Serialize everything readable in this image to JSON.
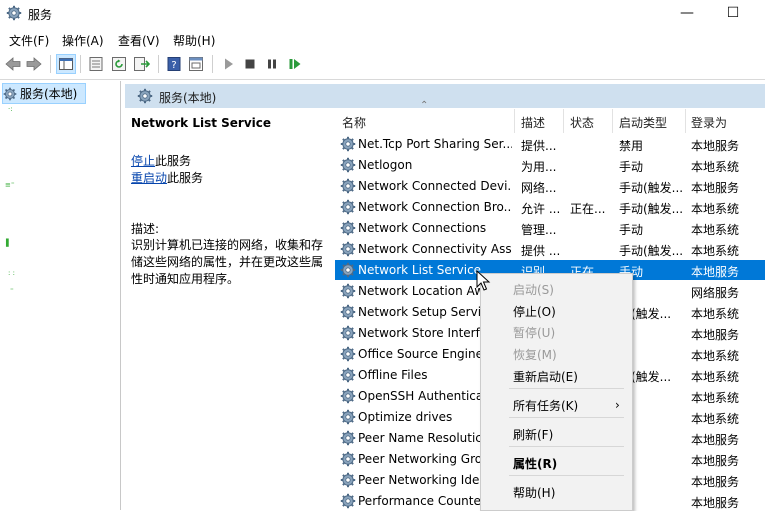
{
  "window": {
    "title": "服务",
    "minimize": "—",
    "maximize": "☐"
  },
  "menu": [
    "文件(F)",
    "操作(A)",
    "查看(V)",
    "帮助(H)"
  ],
  "tree": {
    "root": "服务(本地)"
  },
  "pane": {
    "header": "服务(本地)"
  },
  "detail": {
    "service_name": "Network List Service",
    "stop_link": "停止",
    "stop_suffix": "此服务",
    "restart_link": "重启动",
    "restart_suffix": "此服务",
    "desc_label": "描述:",
    "desc_text": "识别计算机已连接的网络，收集和存储这些网络的属性，并在更改这些属性时通知应用程序。"
  },
  "columns": [
    "名称",
    "描述",
    "状态",
    "启动类型",
    "登录为"
  ],
  "rows": [
    {
      "name": "Net.Tcp Port Sharing Ser...",
      "desc": "提供...",
      "status": "",
      "startup": "禁用",
      "logon": "本地服务"
    },
    {
      "name": "Netlogon",
      "desc": "为用...",
      "status": "",
      "startup": "手动",
      "logon": "本地系统"
    },
    {
      "name": "Network Connected Devi...",
      "desc": "网络...",
      "status": "",
      "startup": "手动(触发...",
      "logon": "本地服务"
    },
    {
      "name": "Network Connection Bro...",
      "desc": "允许 ...",
      "status": "正在...",
      "startup": "手动(触发...",
      "logon": "本地系统"
    },
    {
      "name": "Network Connections",
      "desc": "管理...",
      "status": "",
      "startup": "手动",
      "logon": "本地系统"
    },
    {
      "name": "Network Connectivity Ass...",
      "desc": "提供 ...",
      "status": "",
      "startup": "手动(触发...",
      "logon": "本地系统"
    },
    {
      "name": "Network List Service",
      "desc": "识别...",
      "status": "正在...",
      "startup": "手动",
      "logon": "本地服务",
      "selected": true
    },
    {
      "name": "Network Location Aw",
      "desc": "",
      "status": "",
      "startup": "动",
      "logon": "网络服务"
    },
    {
      "name": "Network Setup Servic",
      "desc": "",
      "status": "",
      "startup": "动(触发...",
      "logon": "本地系统"
    },
    {
      "name": "Network Store Interf",
      "desc": "",
      "status": "",
      "startup": "动",
      "logon": "本地服务"
    },
    {
      "name": "Office  Source Engine",
      "desc": "",
      "status": "",
      "startup": "动",
      "logon": "本地系统"
    },
    {
      "name": "Offline Files",
      "desc": "",
      "status": "",
      "startup": "动(触发...",
      "logon": "本地系统"
    },
    {
      "name": "OpenSSH Authenticat",
      "desc": "",
      "status": "",
      "startup": "用",
      "logon": "本地系统"
    },
    {
      "name": "Optimize drives",
      "desc": "",
      "status": "",
      "startup": "动",
      "logon": "本地系统"
    },
    {
      "name": "Peer Name Resolutic",
      "desc": "",
      "status": "",
      "startup": "动",
      "logon": "本地服务"
    },
    {
      "name": "Peer Networking Gro",
      "desc": "",
      "status": "",
      "startup": "动",
      "logon": "本地服务"
    },
    {
      "name": "Peer Networking Ide",
      "desc": "",
      "status": "",
      "startup": "动",
      "logon": "本地服务"
    },
    {
      "name": "Performance Counter",
      "desc": "",
      "status": "",
      "startup": "动",
      "logon": "本地服务"
    }
  ],
  "context_menu": {
    "start": "启动(S)",
    "stop": "停止(O)",
    "pause": "暂停(U)",
    "resume": "恢复(M)",
    "restart": "重新启动(E)",
    "all_tasks": "所有任务(K)",
    "refresh": "刷新(F)",
    "properties": "属性(R)",
    "help": "帮助(H)",
    "submenu_arrow": "›"
  },
  "colors": {
    "selection": "#0078d7",
    "pane_header": "#cfe0ef",
    "link": "#0645ad"
  }
}
